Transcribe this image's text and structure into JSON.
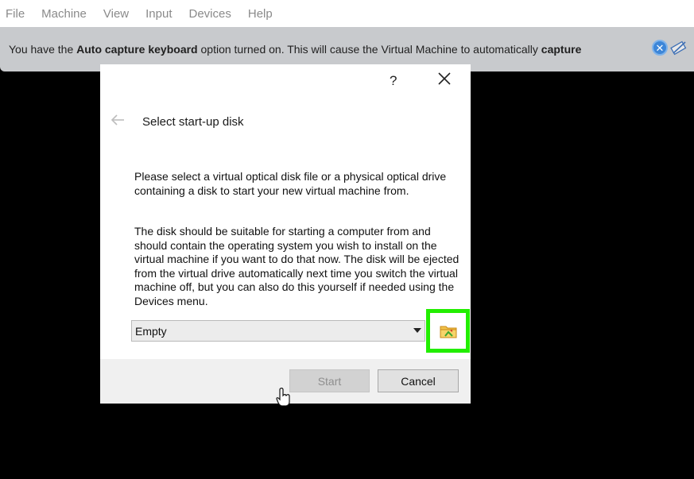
{
  "menubar": {
    "items": [
      "File",
      "Machine",
      "View",
      "Input",
      "Devices",
      "Help"
    ]
  },
  "banner": {
    "text_1": "You have the ",
    "bold_1": "Auto capture keyboard",
    "text_2": " option turned on. This will cause the Virtual Machine to automatically ",
    "bold_2": "capture",
    "close_icon": "close-circle-icon",
    "keyboard_icon": "keyboard-capture-icon"
  },
  "dialog": {
    "help_label": "?",
    "title": "Select start-up disk",
    "paragraph_1": "Please select a virtual optical disk file or a physical optical drive containing a disk to start your new virtual machine from.",
    "paragraph_2": "The disk should be suitable for starting a computer from and should contain the operating system you wish to install on the virtual machine if you want to do that now. The disk will be ejected from the virtual drive automatically next time you switch the virtual machine off, but you can also do this yourself if needed using the Devices menu.",
    "combo_value": "Empty",
    "start_label": "Start",
    "cancel_label": "Cancel",
    "highlight_color": "#22ee00"
  }
}
